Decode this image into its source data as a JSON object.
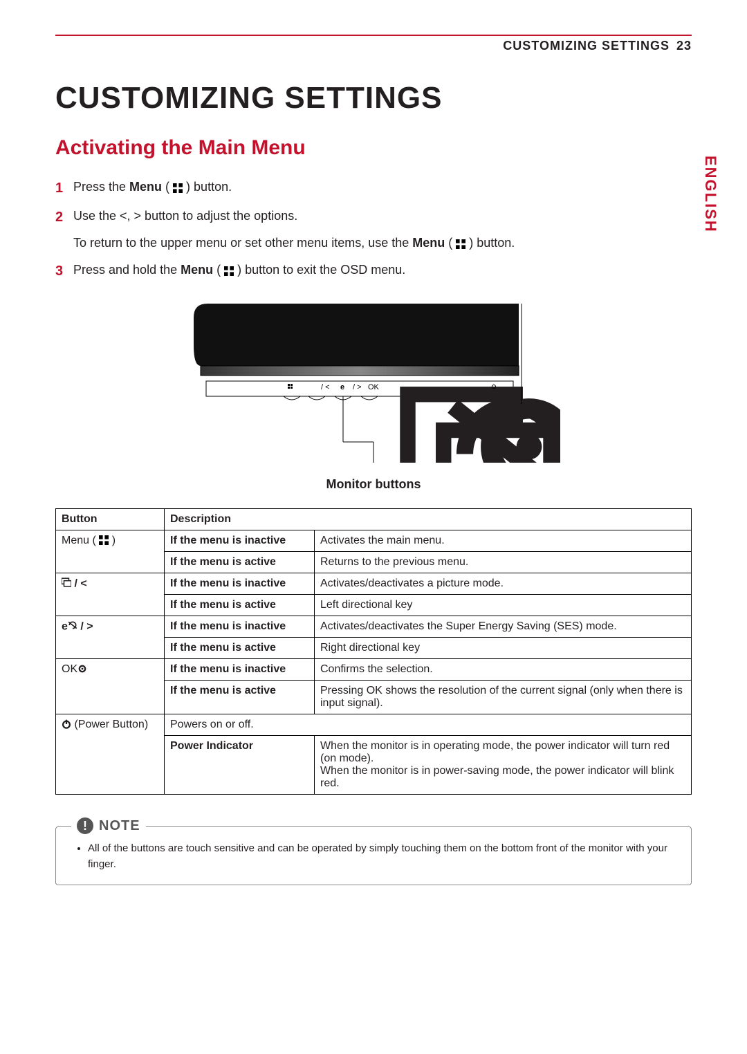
{
  "header": {
    "section": "CUSTOMIZING SETTINGS",
    "page": "23"
  },
  "lang_tab": "ENGLISH",
  "h1": "CUSTOMIZING SETTINGS",
  "h2": "Activating the Main Menu",
  "steps": {
    "s1_a": "Press the ",
    "s1_b": "Menu",
    "s1_c": " ( ",
    "s1_d": " ) button.",
    "s2": "Use the <, > button to adjust the options.",
    "s2_sub_a": "To return to the upper menu or set other menu items, use the ",
    "s2_sub_b": "Menu",
    "s2_sub_c": " ( ",
    "s2_sub_d": " ) button.",
    "s3_a": "Press and hold the ",
    "s3_b": "Menu",
    "s3_c": " ( ",
    "s3_d": " ) button to exit the OSD menu."
  },
  "diagram_caption": "Monitor buttons",
  "diagram_labels": {
    "menu_icon": "",
    "pic": "/ <",
    "eco": "e",
    "eco2": "/ >",
    "ok": "OK",
    "power": ""
  },
  "table": {
    "head": {
      "button": "Button",
      "desc": "Description"
    },
    "menu_label": "Menu ( ",
    "menu_label_end": " )",
    "state_inactive": "If the menu is inactive",
    "state_active": "If the menu is active",
    "menu_inactive": "Activates the main menu.",
    "menu_active": "Returns to the previous menu.",
    "pic_btn": "/ <",
    "pic_inactive": "Activates/deactivates a picture mode.",
    "pic_active": "Left directional key",
    "eco_btn": "e",
    "eco_btn2": "/ >",
    "eco_inactive": "Activates/deactivates the Super Energy Saving (SES) mode.",
    "eco_active": "Right directional key",
    "ok_btn": "OK",
    "ok_inactive": "Confirms the selection.",
    "ok_active": "Pressing OK shows the resolution of the current signal (only when there is input signal).",
    "power_btn": " (Power Button)",
    "power_row": "Powers on or off.",
    "power_ind_label": "Power Indicator",
    "power_ind": "When the monitor is in operating mode, the power indicator will turn red (on mode).\nWhen the monitor is in power-saving mode, the power indicator will blink red."
  },
  "note": {
    "label": "NOTE",
    "item": "All of the buttons are touch sensitive and can be operated by simply touching them on the bottom front of the monitor with your finger."
  }
}
